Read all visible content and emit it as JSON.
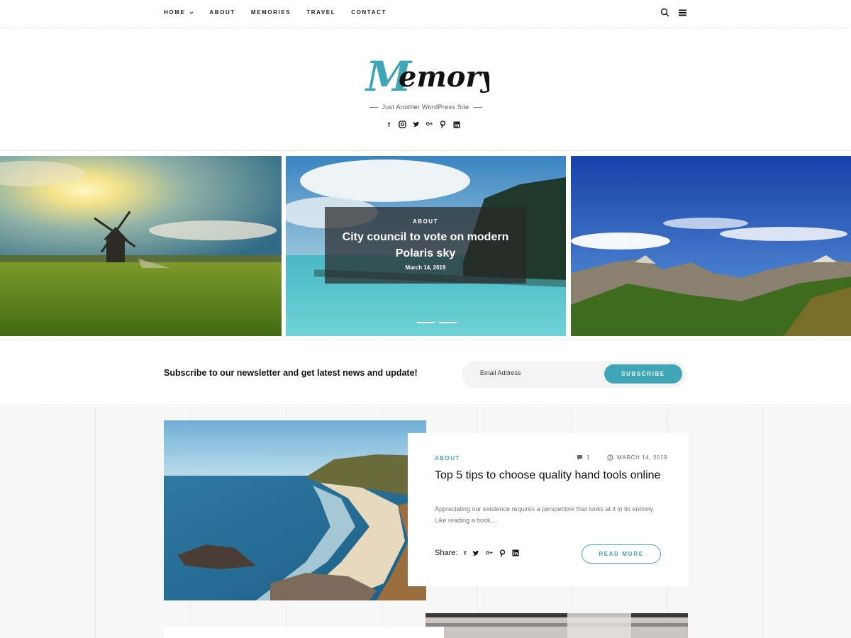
{
  "nav": {
    "items": [
      {
        "label": "HOME",
        "has_dropdown": true
      },
      {
        "label": "ABOUT"
      },
      {
        "label": "MEMORIES"
      },
      {
        "label": "TRAVEL"
      },
      {
        "label": "CONTACT"
      }
    ],
    "icons": [
      "search-icon",
      "hamburger-menu-icon"
    ]
  },
  "header": {
    "logo_text": "Memory",
    "tagline": "Just Another WordPress Site",
    "social": [
      "facebook-icon",
      "instagram-icon",
      "twitter-icon",
      "google-plus-icon",
      "pinterest-icon",
      "linkedin-icon"
    ]
  },
  "slider": {
    "active": {
      "category": "ABOUT",
      "title": "City council to vote on modern Polaris sky",
      "date": "March 14, 2019"
    },
    "indicator_count": 2
  },
  "newsletter": {
    "text": "Subscribe to our newsletter and get latest news and update!",
    "placeholder": "Email Address",
    "button": "SUBSCRIBE"
  },
  "post": {
    "category": "ABOUT",
    "comments": "1",
    "date": "MARCH 14, 2019",
    "title": "Top 5 tips to choose quality hand tools online",
    "excerpt": "Appreciating our existence requires a perspective that looks at it in its entirety. Like reading a book,...",
    "share_label": "Share:",
    "share_icons": [
      "facebook-icon",
      "twitter-icon",
      "google-plus-icon",
      "pinterest-icon",
      "linkedin-icon"
    ],
    "read_more": "READ MORE"
  },
  "colors": {
    "accent": "#3ea6b7",
    "text": "#111111",
    "muted": "#777777",
    "content_bg": "#f7f7f7"
  }
}
